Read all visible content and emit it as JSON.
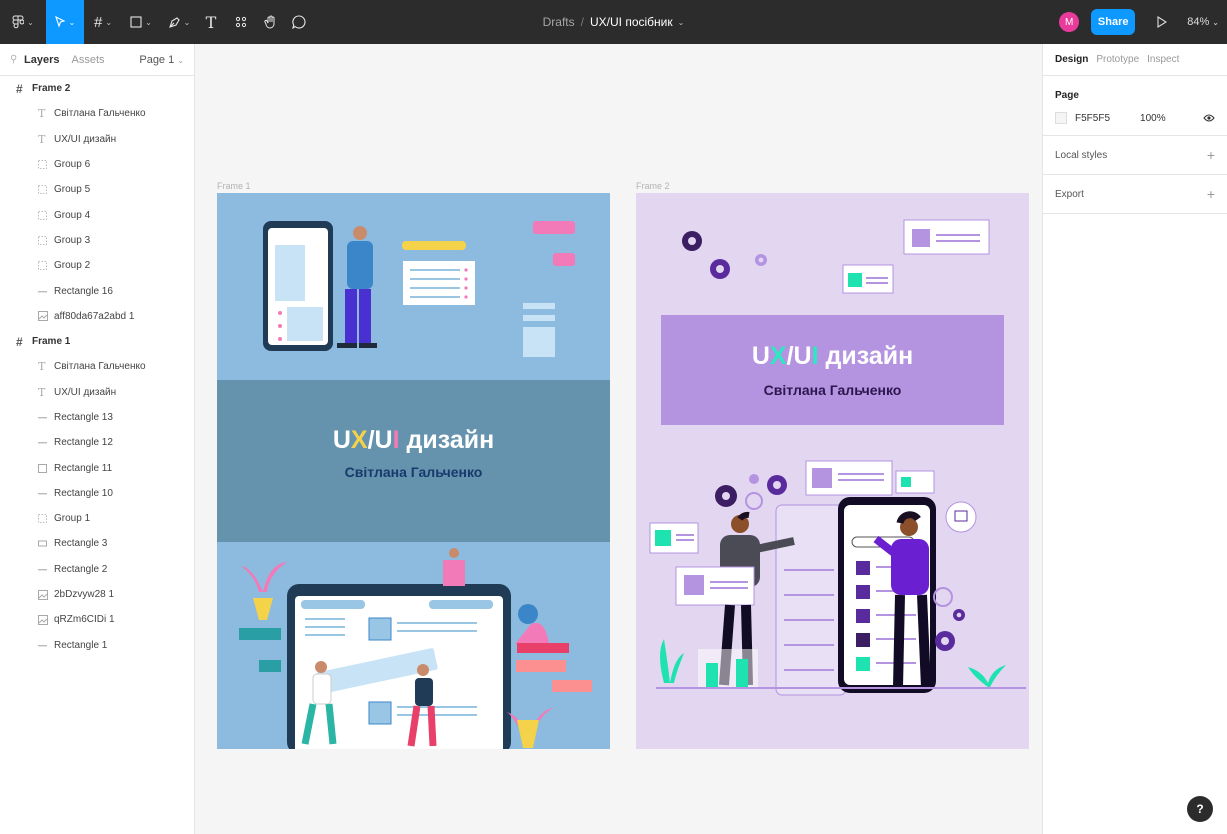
{
  "toolbar": {
    "breadcrumb_drafts": "Drafts",
    "breadcrumb_sep": "/",
    "file_name": "UX/UI посібник",
    "avatar_initial": "M",
    "share_label": "Share",
    "zoom": "84%",
    "tools": [
      "main-menu",
      "move",
      "frame",
      "shape",
      "pen",
      "text",
      "resources",
      "hand",
      "comment"
    ]
  },
  "left_panel": {
    "tabs": [
      "Layers",
      "Assets"
    ],
    "page": "Page 1",
    "layers": [
      {
        "type": "frame",
        "name": "Frame 2"
      },
      {
        "type": "text",
        "name": "Світлана Гальченко"
      },
      {
        "type": "text",
        "name": "UX/UI дизайн"
      },
      {
        "type": "group",
        "name": "Group 6"
      },
      {
        "type": "group",
        "name": "Group 5"
      },
      {
        "type": "group",
        "name": "Group 4"
      },
      {
        "type": "group",
        "name": "Group 3"
      },
      {
        "type": "group",
        "name": "Group 2"
      },
      {
        "type": "line",
        "name": "Rectangle 16"
      },
      {
        "type": "image",
        "name": "aff80da67a2abd 1"
      },
      {
        "type": "frame",
        "name": "Frame 1"
      },
      {
        "type": "text",
        "name": "Світлана Гальченко"
      },
      {
        "type": "text",
        "name": "UX/UI дизайн"
      },
      {
        "type": "line",
        "name": "Rectangle 13"
      },
      {
        "type": "line",
        "name": "Rectangle 12"
      },
      {
        "type": "rect",
        "name": "Rectangle 11"
      },
      {
        "type": "line",
        "name": "Rectangle 10"
      },
      {
        "type": "group",
        "name": "Group 1"
      },
      {
        "type": "rectsm",
        "name": "Rectangle 3"
      },
      {
        "type": "line",
        "name": "Rectangle 2"
      },
      {
        "type": "image",
        "name": "2bDzvyw28 1"
      },
      {
        "type": "image",
        "name": "qRZm6CIDi 1"
      },
      {
        "type": "line",
        "name": "Rectangle 1"
      }
    ]
  },
  "right_panel": {
    "tabs": [
      "Design",
      "Prototype",
      "Inspect"
    ],
    "page_title": "Page",
    "page_color": "F5F5F5",
    "page_opacity": "100%",
    "local_styles": "Local styles",
    "export": "Export"
  },
  "canvas": {
    "frame1_label": "Frame 1",
    "frame2_label": "Frame 2",
    "title_u": "U",
    "title_x": "X",
    "title_slash": "/",
    "title_ui": "U",
    "title_i": "I",
    "title_rest": " дизайн",
    "author": "Світлана Гальченко"
  },
  "help_label": "?",
  "colors": {
    "toolbar": "#2c2c2c",
    "accent": "#0d99ff",
    "frame1_bg": "#8dbadf",
    "frame1_band": "#6593ae",
    "frame2_bg": "#e2d6f1",
    "frame2_box": "#b493e0",
    "yellow": "#f4d34b",
    "teal": "#2ce8c3",
    "pink": "#f27ab8"
  }
}
